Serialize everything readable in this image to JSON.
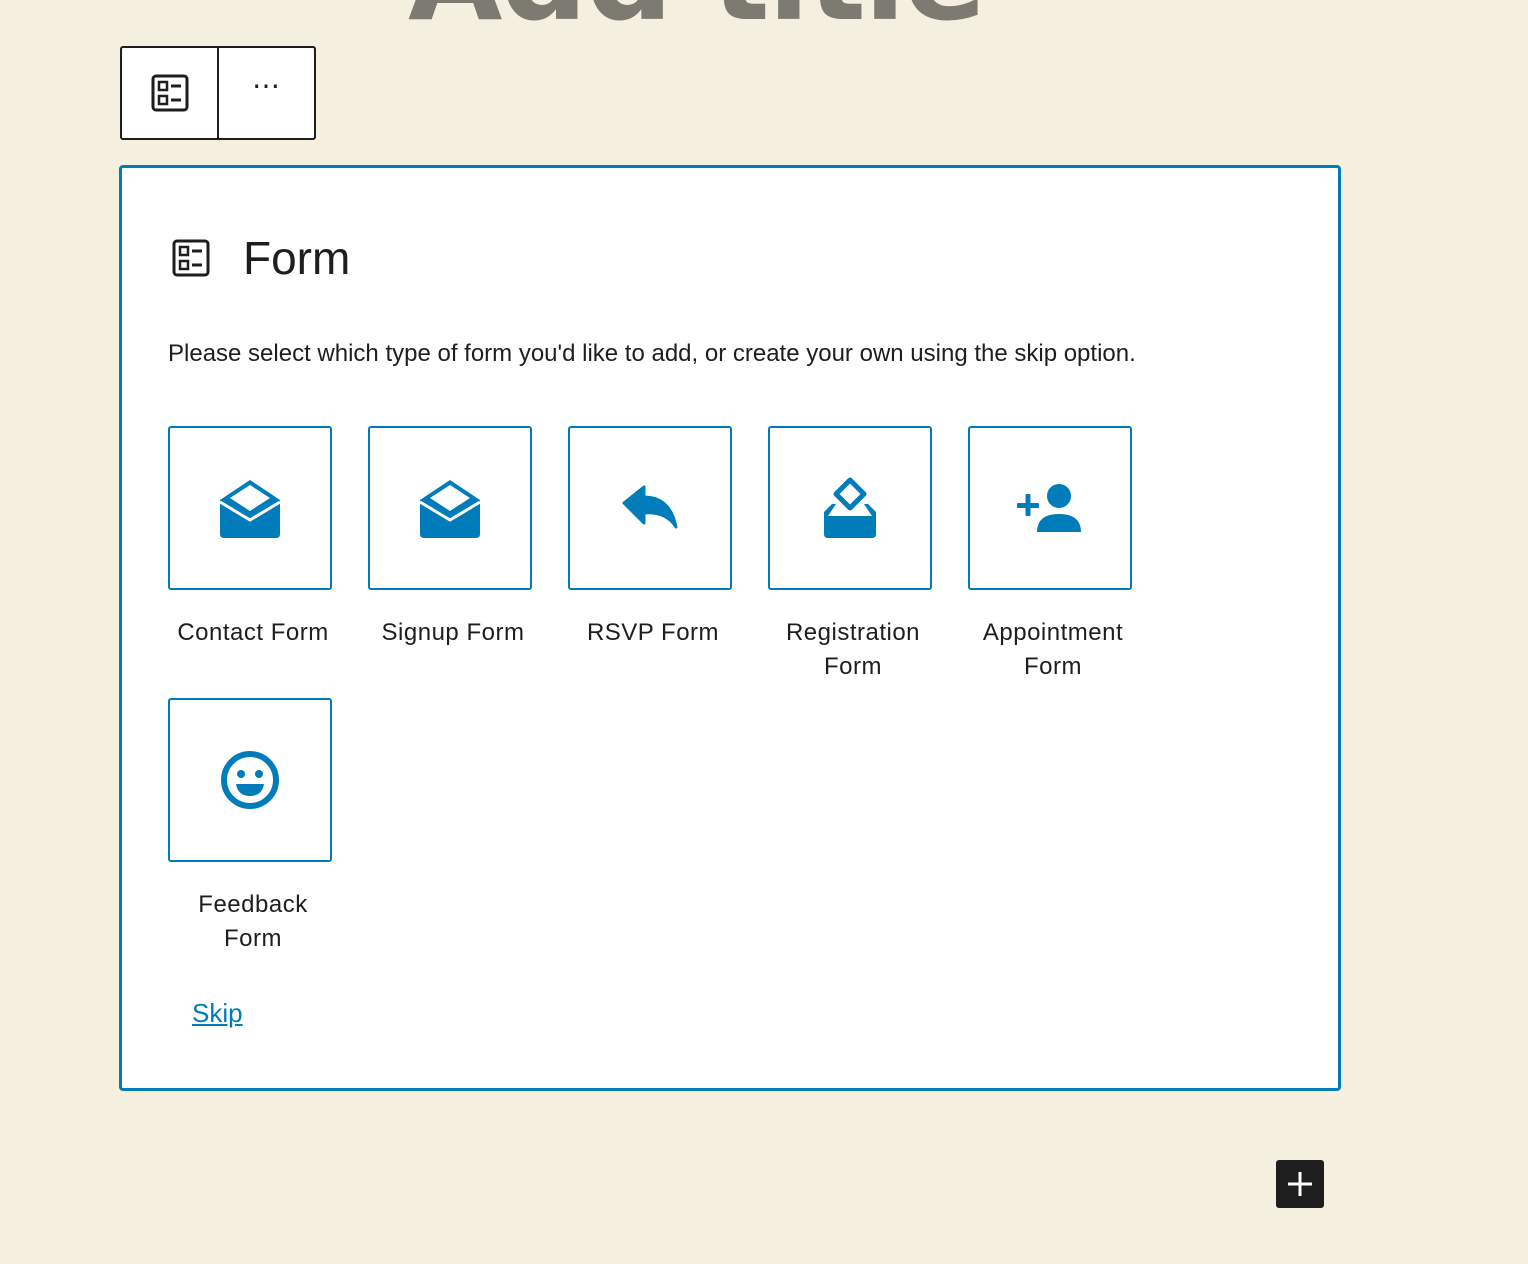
{
  "page": {
    "title": "Add title"
  },
  "toolbar": {
    "block_icon": "form-block-icon",
    "more_options": "⋯"
  },
  "form_block": {
    "title": "Form",
    "instructions": "Please select which type of form you'd like to add, or create your own using the skip option.",
    "variations": [
      {
        "label": "Contact Form",
        "icon": "envelope-open-icon"
      },
      {
        "label": "Signup Form",
        "icon": "envelope-open-icon"
      },
      {
        "label": "RSVP Form",
        "icon": "reply-arrow-icon"
      },
      {
        "label": "Registration Form",
        "icon": "ballot-box-icon"
      },
      {
        "label": "Appointment Form",
        "icon": "add-person-icon"
      },
      {
        "label": "Feedback Form",
        "icon": "smiley-face-icon"
      }
    ],
    "skip_label": "Skip"
  },
  "inserter": {
    "icon": "plus-icon"
  },
  "colors": {
    "accent": "#007cba",
    "background": "#f5efdf",
    "dark": "#1e1e1e",
    "title_gray": "#7d7a72"
  }
}
